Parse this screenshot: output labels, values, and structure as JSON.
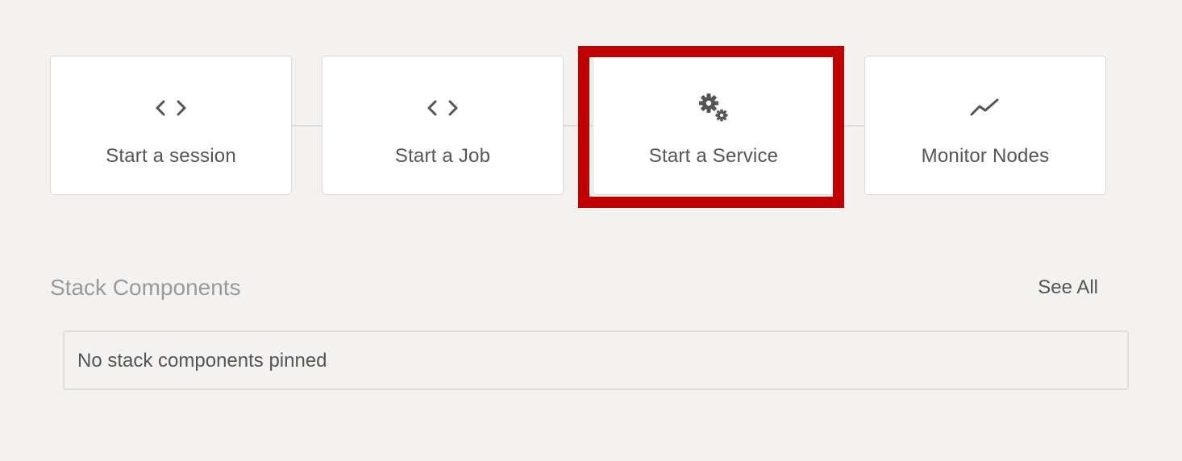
{
  "actions": [
    {
      "label": "Start a session",
      "icon": "code-icon"
    },
    {
      "label": "Start a Job",
      "icon": "code-icon"
    },
    {
      "label": "Start a Service",
      "icon": "gears-icon"
    },
    {
      "label": "Monitor Nodes",
      "icon": "trend-line-icon"
    }
  ],
  "highlight": {
    "target": "Start a Service",
    "color": "#c00000"
  },
  "stack_components": {
    "title": "Stack Components",
    "see_all_label": "See All",
    "empty_message": "No stack components pinned"
  },
  "colors": {
    "background": "#f3f2f1",
    "card_background": "#ffffff",
    "text": "#555555",
    "muted_text": "#9a9a9a"
  }
}
